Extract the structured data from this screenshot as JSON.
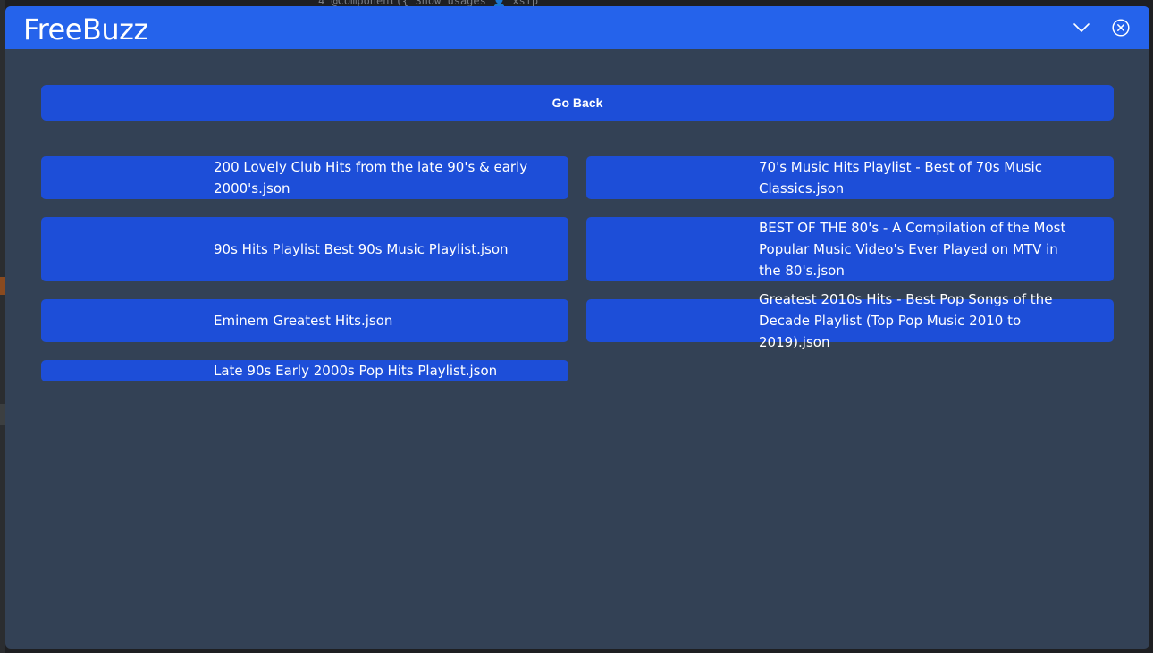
{
  "app": {
    "title": "FreeBuzz"
  },
  "background": {
    "code_snippet": "4        @Component({   Show usages   👤 xsip"
  },
  "actions": {
    "go_back_label": "Go Back"
  },
  "playlists": [
    "200 Lovely Club Hits from the late 90's & early 2000's.json",
    "70's Music Hits Playlist - Best of 70s Music Classics.json",
    "90s Hits Playlist Best 90s Music Playlist.json",
    "BEST OF THE 80's - A Compilation of the Most Popular Music Video's Ever Played on MTV in the 80's.json",
    "Eminem Greatest Hits.json",
    "Greatest 2010s Hits - Best Pop Songs of the Decade Playlist (Top Pop Music 2010 to 2019).json",
    "Late 90s Early 2000s Pop Hits Playlist.json"
  ],
  "icons": {
    "minimize": "chevron-down-icon",
    "close": "close-circle-icon"
  },
  "colors": {
    "titlebar": "#2563eb",
    "button": "#1d4ed8",
    "panel": "#334155",
    "text": "#ffffff"
  }
}
